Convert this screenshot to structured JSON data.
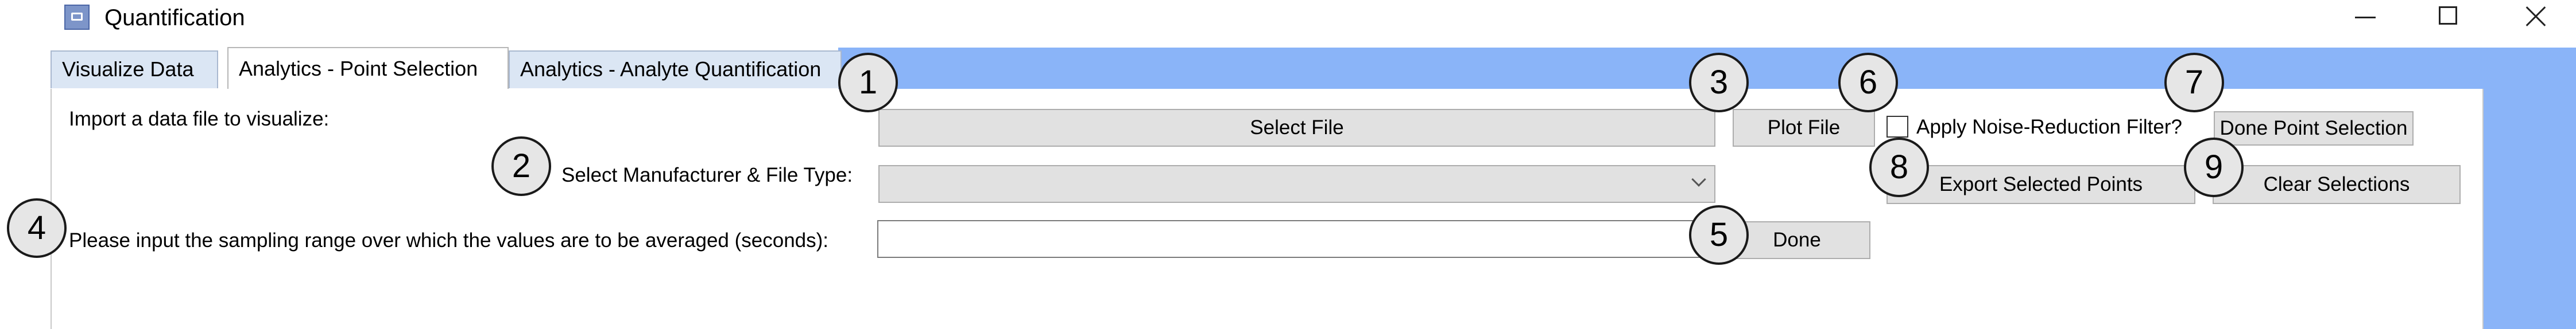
{
  "window": {
    "title": "Quantification"
  },
  "tabs": [
    {
      "label": "Visualize Data",
      "active": false
    },
    {
      "label": "Analytics - Point Selection",
      "active": true
    },
    {
      "label": "Analytics - Analyte Quantification",
      "active": false
    }
  ],
  "form": {
    "import_label": "Import a data file to visualize:",
    "select_file_button": "Select File",
    "plot_file_button": "Plot File",
    "noise_filter_label": "Apply Noise-Reduction Filter?",
    "noise_filter_checked": false,
    "done_point_selection_button": "Done Point Selection",
    "manufacturer_label": "Select Manufacturer & File Type:",
    "manufacturer_value": "",
    "export_button": "Export Selected Points",
    "clear_button": "Clear Selections",
    "sampling_label": "Please input the sampling range over which the values are to be averaged (seconds):",
    "sampling_value": "",
    "done_button": "Done"
  },
  "markers": [
    "1",
    "2",
    "3",
    "4",
    "5",
    "6",
    "7",
    "8",
    "9"
  ],
  "colors": {
    "accent_blue": "#8ab4f8",
    "button_gray": "#e1e1e1",
    "tab_inactive": "#dbe6f4"
  }
}
